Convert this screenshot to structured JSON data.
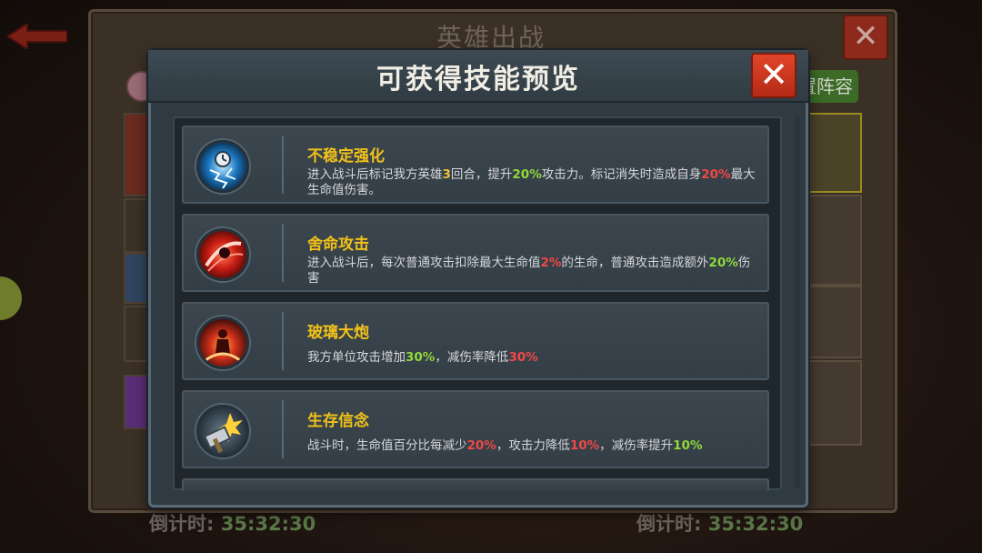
{
  "background": {
    "title": "英雄出战",
    "close_label": "✕",
    "right_button_label": "置阵容",
    "countdown_left_label": "倒计时:",
    "countdown_left_time": "35:32:30",
    "countdown_right_label": "倒计时:",
    "countdown_right_time": "35:32:30"
  },
  "modal": {
    "title": "可获得技能预览",
    "close_label": "✕",
    "skills": [
      {
        "name": "不稳定强化",
        "icon": "lightning-clock-icon",
        "desc": [
          {
            "t": "进入战斗后标记我方英雄",
            "c": ""
          },
          {
            "t": "3",
            "c": "hl"
          },
          {
            "t": "回合，提升",
            "c": ""
          },
          {
            "t": "20%",
            "c": "g"
          },
          {
            "t": "攻击力。标记消失时造成自身",
            "c": ""
          },
          {
            "t": "20%",
            "c": "r"
          },
          {
            "t": "最大生命值伤害。",
            "c": ""
          }
        ]
      },
      {
        "name": "舍命攻击",
        "icon": "red-slash-icon",
        "desc": [
          {
            "t": "进入战斗后，每次普通攻击扣除最大生命值",
            "c": ""
          },
          {
            "t": "2%",
            "c": "r"
          },
          {
            "t": "的生命，普通攻击造成额外",
            "c": ""
          },
          {
            "t": "20%",
            "c": "g"
          },
          {
            "t": "伤害",
            "c": ""
          }
        ]
      },
      {
        "name": "玻璃大炮",
        "icon": "fire-figure-icon",
        "desc": [
          {
            "t": "我方单位攻击增加",
            "c": ""
          },
          {
            "t": "30%",
            "c": "g"
          },
          {
            "t": "，减伤率降低",
            "c": ""
          },
          {
            "t": "30%",
            "c": "r"
          }
        ]
      },
      {
        "name": "生存信念",
        "icon": "hammer-burst-icon",
        "desc": [
          {
            "t": "战斗时，生命值百分比每减少",
            "c": ""
          },
          {
            "t": "20%",
            "c": "r"
          },
          {
            "t": "，攻击力降低",
            "c": ""
          },
          {
            "t": "10%",
            "c": "r"
          },
          {
            "t": "，减伤率提升",
            "c": ""
          },
          {
            "t": "10%",
            "c": "g"
          }
        ]
      }
    ]
  }
}
